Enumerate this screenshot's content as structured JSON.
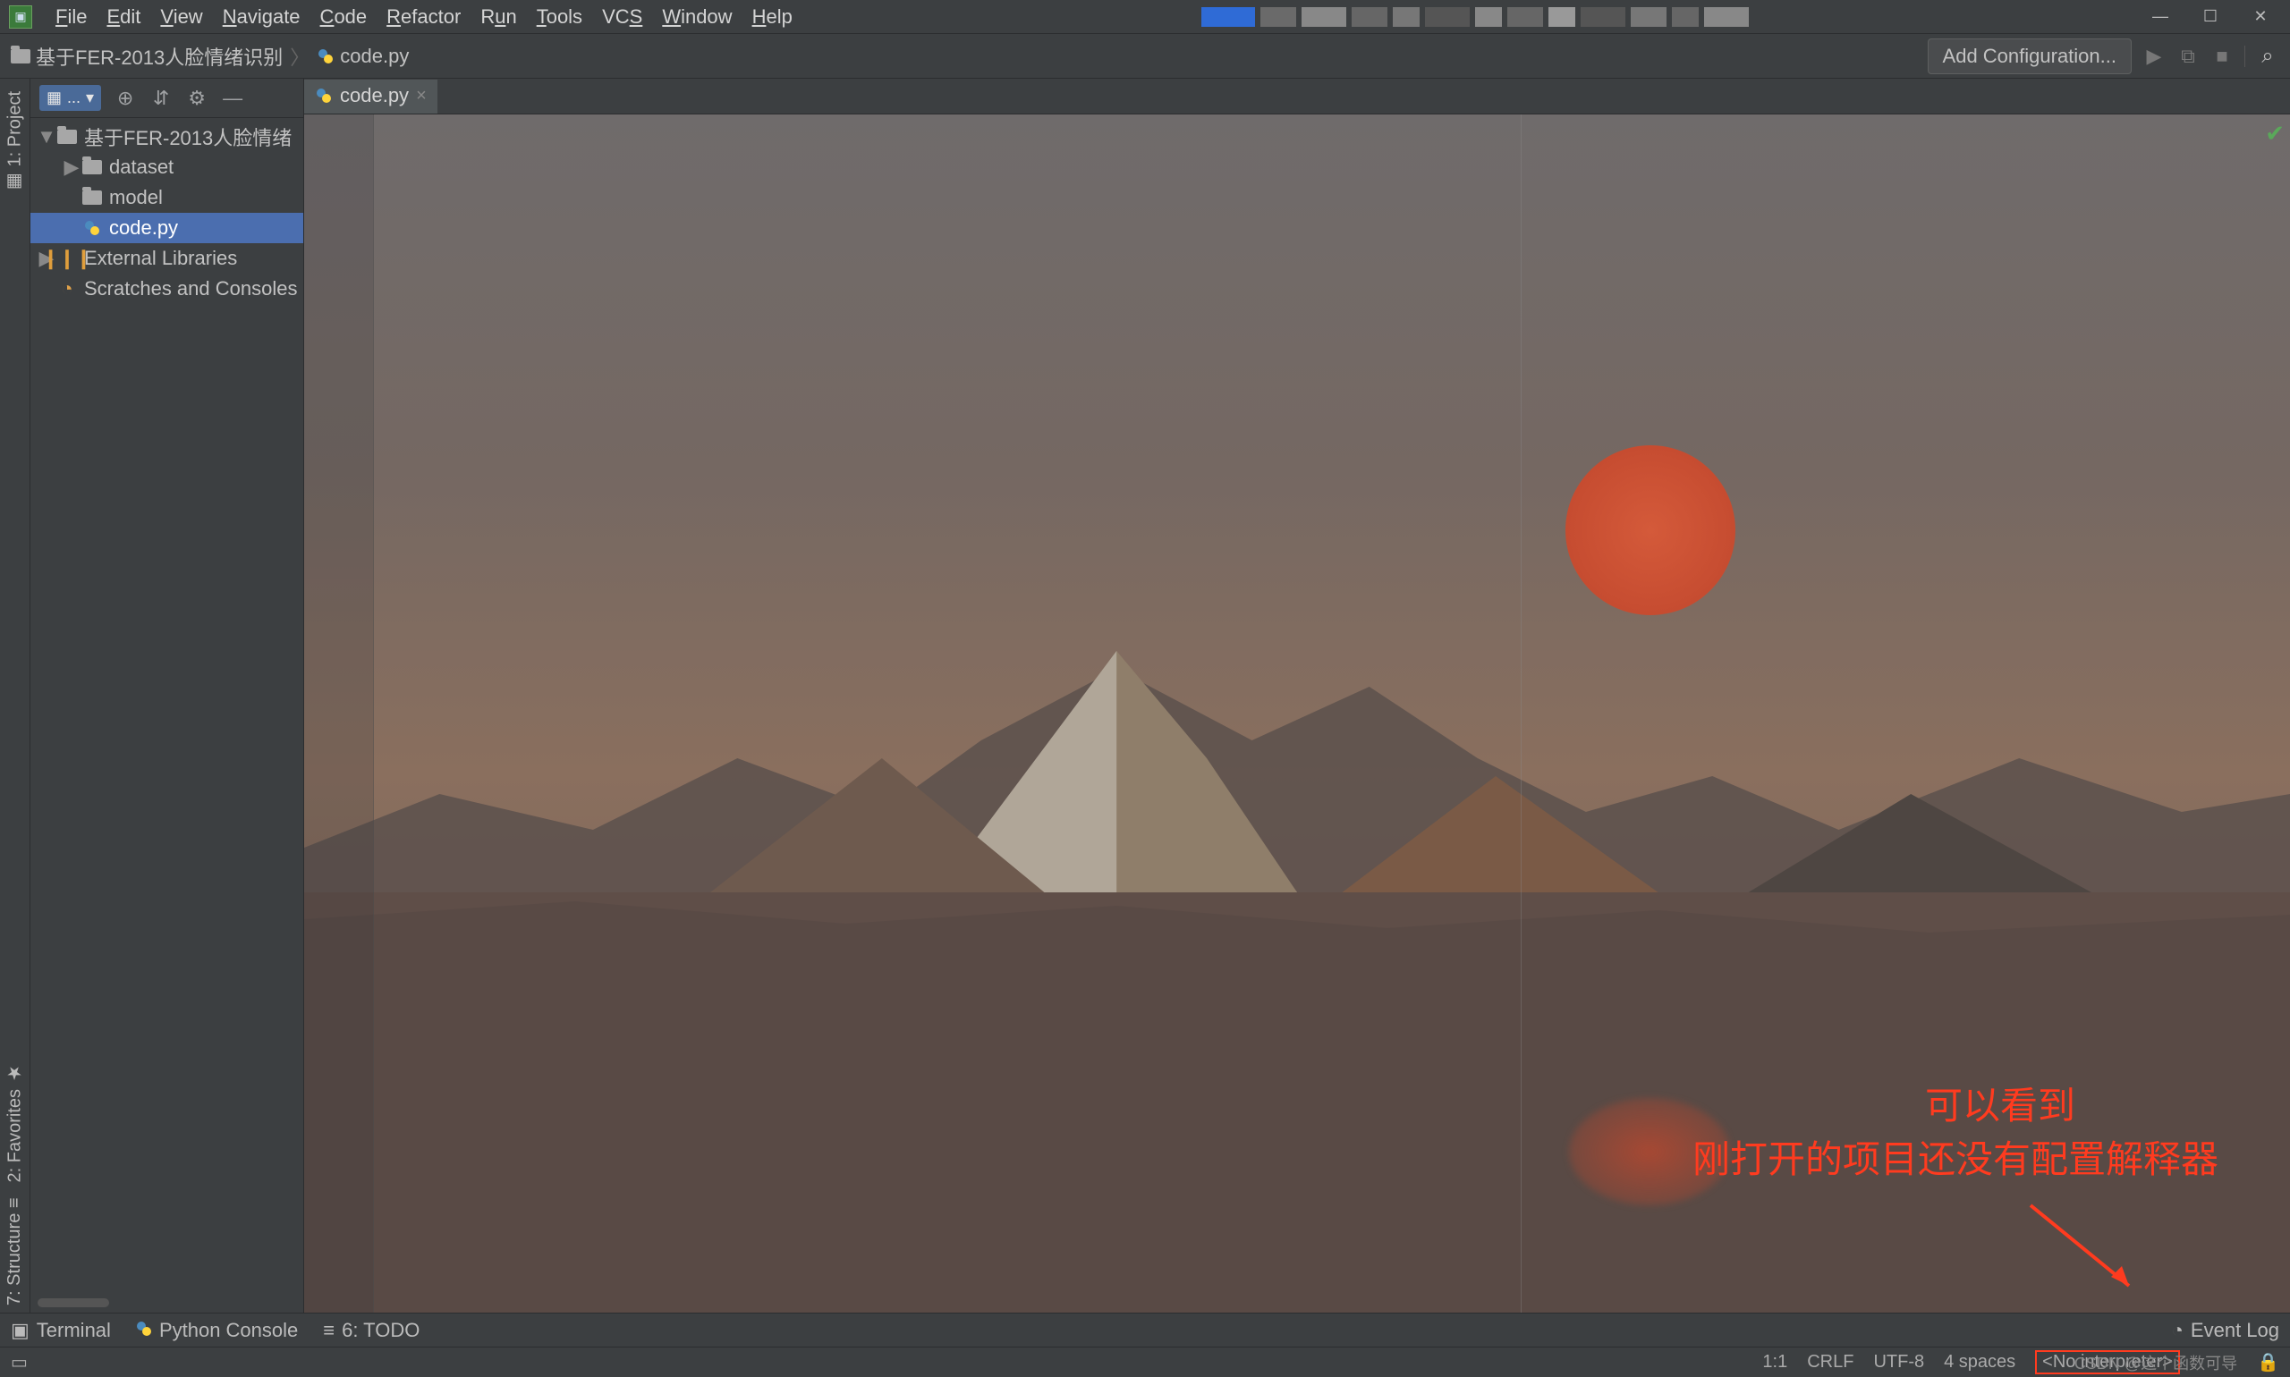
{
  "menu": [
    "File",
    "Edit",
    "View",
    "Navigate",
    "Code",
    "Refactor",
    "Run",
    "Tools",
    "VCS",
    "Window",
    "Help"
  ],
  "breadcrumb": {
    "root": "基于FER-2013人脸情绪识别",
    "file": "code.py"
  },
  "navbar": {
    "add_config": "Add Configuration..."
  },
  "left_strips": {
    "project": "1: Project",
    "favorites": "2: Favorites",
    "structure": "7: Structure"
  },
  "project_panel": {
    "selector": "...",
    "root": "基于FER-2013人脸情绪",
    "items": [
      {
        "label": "dataset",
        "type": "folder",
        "level": 1,
        "expandable": true
      },
      {
        "label": "model",
        "type": "folder",
        "level": 1,
        "expandable": false
      },
      {
        "label": "code.py",
        "type": "py",
        "level": 1,
        "selected": true
      }
    ],
    "external_libs": "External Libraries",
    "scratches": "Scratches and Consoles"
  },
  "editor": {
    "tab": "code.py"
  },
  "annotation": {
    "line1": "可以看到",
    "line2": "刚打开的项目还没有配置解释器"
  },
  "bottom": {
    "terminal": "Terminal",
    "python_console": "Python Console",
    "todo": "6: TODO",
    "event_log": "Event Log"
  },
  "status": {
    "position": "1:1",
    "line_sep": "CRLF",
    "encoding": "UTF-8",
    "indent": "4 spaces",
    "interpreter": "<No interpreter>",
    "watermark": "CSDN @这个函数可导"
  }
}
